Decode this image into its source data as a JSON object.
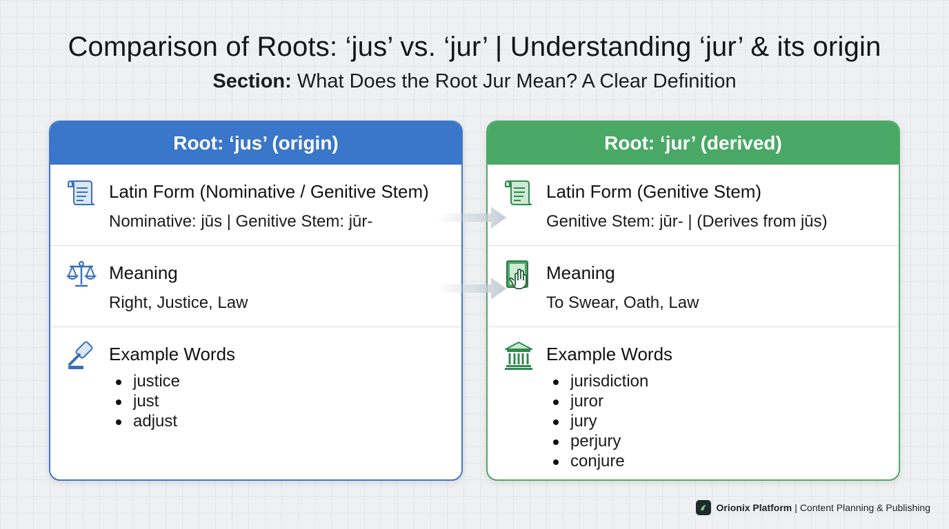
{
  "title": "Comparison of Roots: ‘jus’ vs. ‘jur’ | Understanding ‘jur’ & its origin",
  "subtitle": {
    "label": "Section:",
    "text": "What Does the Root Jur Mean? A Clear Definition"
  },
  "colors": {
    "blue": "#3a76c9",
    "green": "#4aa866"
  },
  "left_card": {
    "header": "Root: ‘jus’ (origin)",
    "rows": [
      {
        "icon": "scroll-icon",
        "title": "Latin Form (Nominative / Genitive Stem)",
        "text": "Nominative: jūs | Genitive Stem: jūr-"
      },
      {
        "icon": "scales-icon",
        "title": "Meaning",
        "text": "Right, Justice, Law"
      },
      {
        "icon": "gavel-icon",
        "title": "Example Words",
        "items": [
          "justice",
          "just",
          "adjust"
        ]
      }
    ]
  },
  "right_card": {
    "header": "Root: ‘jur’ (derived)",
    "rows": [
      {
        "icon": "scroll-icon",
        "title": "Latin Form (Genitive Stem)",
        "text": "Genitive Stem: jūr- | (Derives from jūs)"
      },
      {
        "icon": "oath-hand-book-icon",
        "title": "Meaning",
        "text": "To Swear, Oath, Law"
      },
      {
        "icon": "courthouse-icon",
        "title": "Example Words",
        "items": [
          "jurisdiction",
          "juror",
          "jury",
          "perjury",
          "conjure"
        ]
      }
    ]
  },
  "footer": {
    "brand": "Orionix Platform",
    "separator": "|",
    "tagline": "Content Planning & Publishing"
  }
}
